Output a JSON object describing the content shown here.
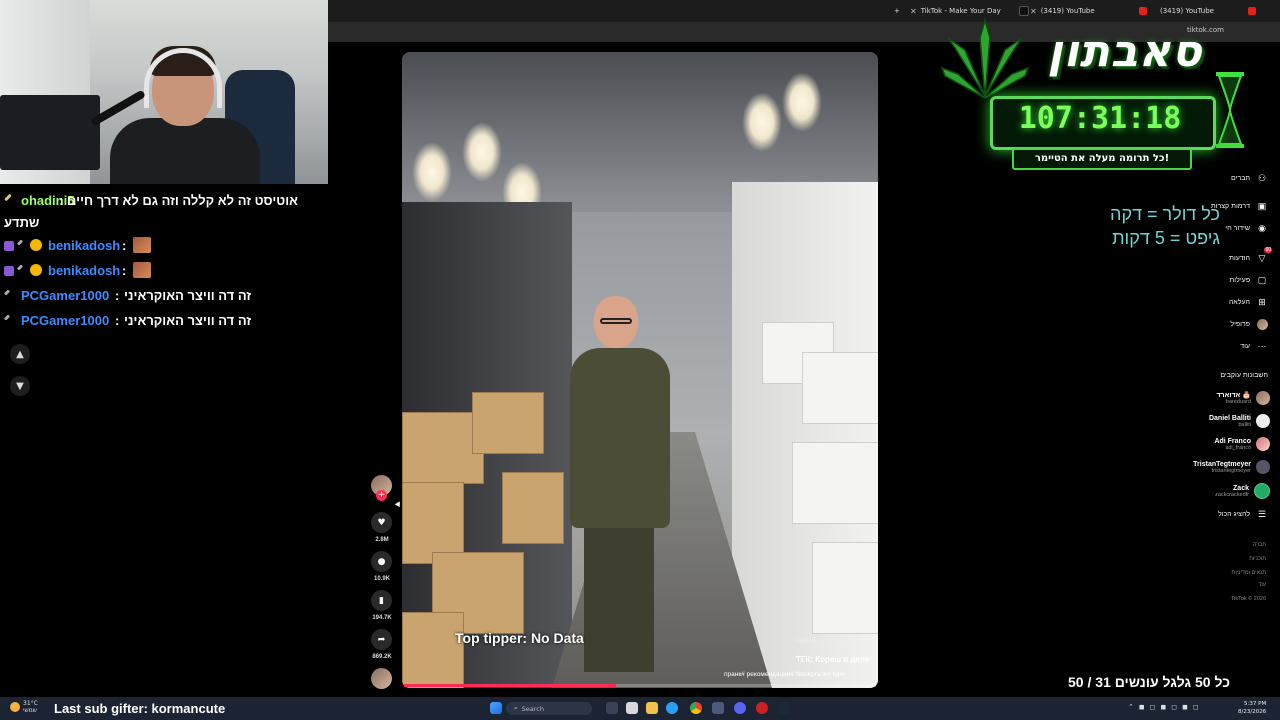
{
  "browser": {
    "tabs": [
      {
        "label": "TikTok - Make Your Day"
      },
      {
        "label": "(3419) YouTube"
      },
      {
        "label": "(3419) YouTube"
      }
    ],
    "url": "tiktok.com"
  },
  "chat": {
    "messages": [
      {
        "user": "ohadini5",
        "separator": ":",
        "text": "אוטיסט זה לא קללה וזה גם לא דרך חיים",
        "text_cont": "שתדע",
        "user_color": "#9cff6a"
      },
      {
        "user": "benikadosh",
        "separator": ":",
        "text": "",
        "user_color": "#3d8bff"
      },
      {
        "user": "benikadosh",
        "separator": ":",
        "text": "",
        "user_color": "#3d8bff"
      },
      {
        "user": "PCGamer1000",
        "separator": ":",
        "text": "זה דה וויצר האוקראיני",
        "user_color": "#3d8bff"
      },
      {
        "user": "PCGamer1000",
        "separator": ":",
        "text": "זה דה וויצר האוקראיני",
        "user_color": "#3d8bff"
      }
    ],
    "scroll_up": "▲",
    "scroll_down": "▼"
  },
  "video": {
    "progress": 0.45,
    "capcut": "CapCut · נישום העריכה",
    "title": "ТГК: Кореш в деле",
    "hashtags": "пранк# рекомендации# tiktokprank# fyp#"
  },
  "actions": {
    "likes": "2.8M",
    "comments": "10.9K",
    "saves": "194.7K",
    "shares": "869.2K"
  },
  "sidebar": {
    "nav": [
      {
        "label": "חברים",
        "icon": "friends-icon"
      },
      {
        "label": "דרמות קצרות",
        "icon": "drama-icon"
      },
      {
        "label": "שידור חי",
        "icon": "live-icon"
      },
      {
        "label": "הודעות",
        "icon": "messages-icon",
        "badge": "60"
      },
      {
        "label": "פעילות",
        "icon": "activity-icon"
      },
      {
        "label": "העלאה",
        "icon": "upload-icon"
      },
      {
        "label": "פרופיל",
        "icon": "profile-icon"
      },
      {
        "label": "עוד",
        "icon": "more-icon"
      }
    ],
    "following_title": "חשבונות עוקבים",
    "accounts": [
      {
        "name": "אדוארד 🎂",
        "handle": "bareduard"
      },
      {
        "name": "Daniel Balliti",
        "handle": "balliti"
      },
      {
        "name": "Adi Franco",
        "handle": "adi_franco"
      },
      {
        "name": "TristanTegtmeyer",
        "handle": "tristantegtmeyer"
      },
      {
        "name": "Zack",
        "handle": "zackcrackedfr"
      }
    ],
    "show_all": "להציג הכול",
    "footer": [
      "חברה",
      "תוכניות",
      "תנאים ומדיניות",
      "עוד",
      "TikTok © 2026"
    ]
  },
  "subathon": {
    "logo": "סאבתון",
    "timer": "107:31:18",
    "subtitle": "כל תרומה מעלה את הטיימר!",
    "rule1": "כל דולר = דקה",
    "rule2": "גיפט = 5 דקות"
  },
  "overlay": {
    "top_tipper": "Top tipper: No Data",
    "goal": "כל 50 גלגל עונשים 31 / 50",
    "last_sub": "Last sub gifter: kormancute"
  },
  "taskbar": {
    "weather_temp": "31°C",
    "weather_desc": "שמשי",
    "search": "Search",
    "time": "5:37 PM",
    "date": "8/23/2026"
  },
  "colors": {
    "tiktok_red": "#fe2c55",
    "timer_green": "#7bff5a",
    "rule_cyan": "#6fd6d6"
  }
}
